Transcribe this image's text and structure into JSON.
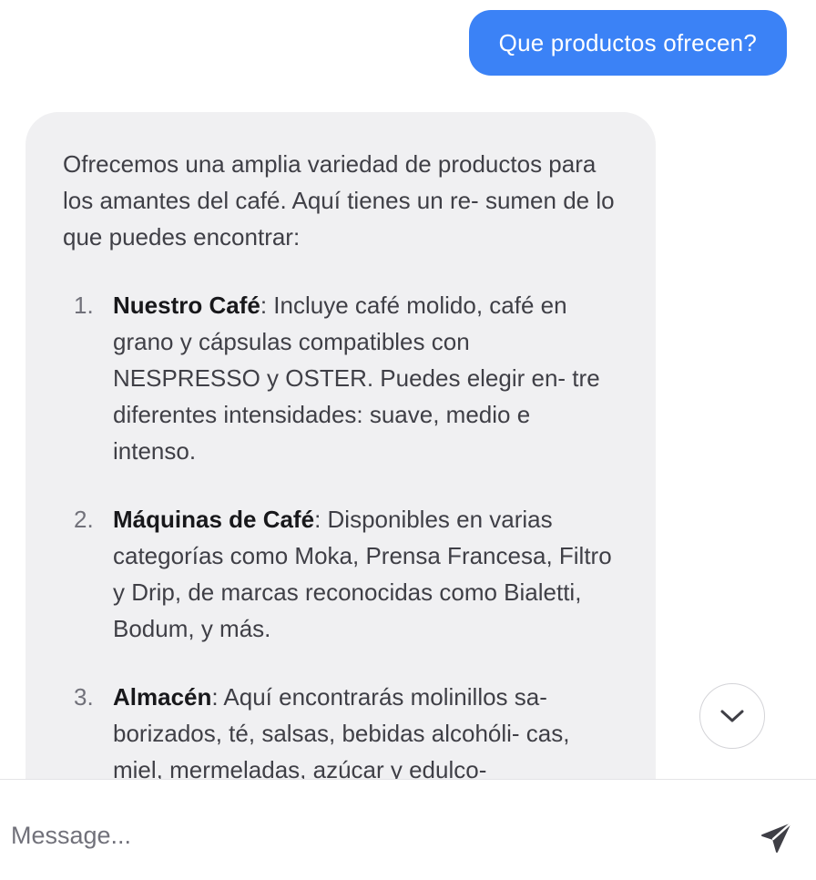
{
  "user_message": "Que productos ofrecen?",
  "bot_message": {
    "intro": "Ofrecemos una amplia variedad de productos para los amantes del café. Aquí tienes un re- sumen de lo que puedes encontrar:",
    "items": [
      {
        "number": "1.",
        "title": "Nuestro Café",
        "text": ": Incluye café molido, café en grano y cápsulas compatibles con NESPRESSO y OSTER. Puedes elegir en- tre diferentes intensidades: suave, medio e intenso."
      },
      {
        "number": "2.",
        "title": "Máquinas de Café",
        "text": ": Disponibles en varias categorías como Moka, Prensa Francesa, Filtro y Drip, de marcas reconocidas como Bialetti, Bodum, y más."
      },
      {
        "number": "3.",
        "title": "Almacén",
        "text": ": Aquí encontrarás molinillos sa- borizados, té, salsas, bebidas alcohóli- cas, miel, mermeladas, azúcar y edulco-"
      }
    ]
  },
  "composer": {
    "placeholder": "Message..."
  },
  "icons": {
    "scroll": "chevron-down-icon",
    "send": "send-icon"
  },
  "colors": {
    "user_bubble": "#3b82f6",
    "bot_bubble": "#f0f0f2"
  }
}
